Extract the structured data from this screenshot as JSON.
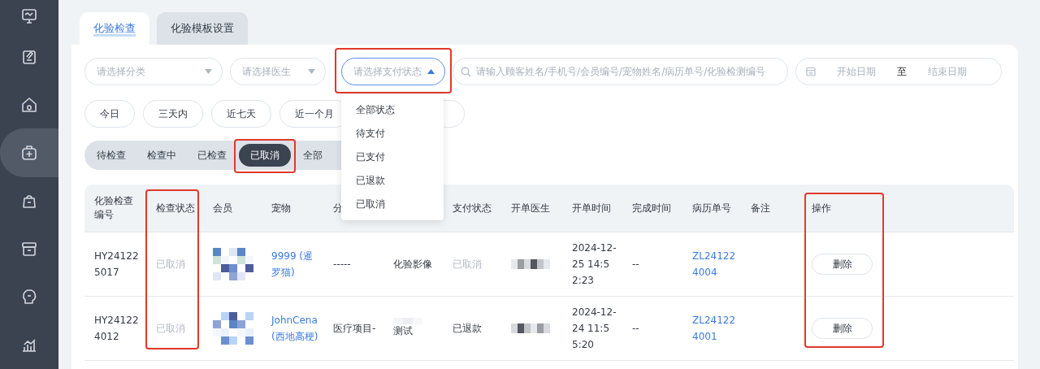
{
  "sidebar": {
    "items": [
      {
        "selected": false
      },
      {
        "selected": false
      },
      {
        "selected": false
      },
      {
        "selected": true
      },
      {
        "selected": false
      },
      {
        "selected": false
      },
      {
        "selected": false
      },
      {
        "selected": false
      }
    ]
  },
  "tabs": [
    {
      "label": "化验检查",
      "selected": true
    },
    {
      "label": "化验模板设置",
      "selected": false
    }
  ],
  "filters": {
    "category": {
      "placeholder": "请选择分类",
      "open": false,
      "highlighted": false
    },
    "doctor": {
      "placeholder": "请选择医生",
      "open": false,
      "highlighted": false
    },
    "payment": {
      "placeholder": "请选择支付状态",
      "open": true,
      "highlighted": true,
      "options": [
        "全部状态",
        "待支付",
        "已支付",
        "已退款",
        "已取消"
      ]
    },
    "search": {
      "placeholder": "请输入顾客姓名/手机号/会员编号/宠物姓名/病历单号/化验检测编号"
    },
    "date_range": {
      "start_placeholder": "开始日期",
      "separator": "至",
      "end_placeholder": "结束日期"
    }
  },
  "quick_ranges": [
    "今日",
    "三天内",
    "近七天",
    "近一个月"
  ],
  "status_tabs": [
    {
      "label": "待检查",
      "selected": false,
      "highlighted": false
    },
    {
      "label": "检查中",
      "selected": false,
      "highlighted": false
    },
    {
      "label": "已检查",
      "selected": false,
      "highlighted": false
    },
    {
      "label": "已取消",
      "selected": true,
      "highlighted": true
    },
    {
      "label": "全部",
      "selected": false,
      "highlighted": false
    }
  ],
  "table": {
    "columns": [
      {
        "label": "化验检查编号",
        "highlighted": false
      },
      {
        "label": "检查状态",
        "highlighted": true
      },
      {
        "label": "会员",
        "highlighted": false
      },
      {
        "label": "宠物",
        "highlighted": false
      },
      {
        "label": "分",
        "highlighted": false
      },
      {
        "highlighted": false
      },
      {
        "label": "支付状态",
        "highlighted": false
      },
      {
        "label": "开单医生",
        "highlighted": false
      },
      {
        "label": "开单时间",
        "highlighted": false
      },
      {
        "label": "完成时间",
        "highlighted": false
      },
      {
        "label": "病历单号",
        "highlighted": false
      },
      {
        "label": "备注",
        "highlighted": false
      },
      {
        "label": "操作",
        "highlighted": true
      }
    ],
    "rows": [
      {
        "id": "HY241225017",
        "check_status": {
          "text": "已取消",
          "muted": true
        },
        "pet": "9999 (暹罗猫)",
        "category": "-----",
        "item": "化验影像",
        "payment_status": {
          "text": "已取消",
          "muted": true
        },
        "created": "2024-12-25 14:52:23",
        "finished": "--",
        "record_no": "ZL241224004",
        "action": "删除"
      },
      {
        "id": "HY241224012",
        "check_status": {
          "text": "已取消",
          "muted": true
        },
        "pet": "JohnCena (西地高梗)",
        "category": "医疗项目-",
        "item": "测试",
        "payment_status": {
          "text": "已退款",
          "muted": false
        },
        "created": "2024-12-24 11:55:20",
        "finished": "--",
        "record_no": "ZL241224001",
        "action": "删除"
      }
    ]
  }
}
